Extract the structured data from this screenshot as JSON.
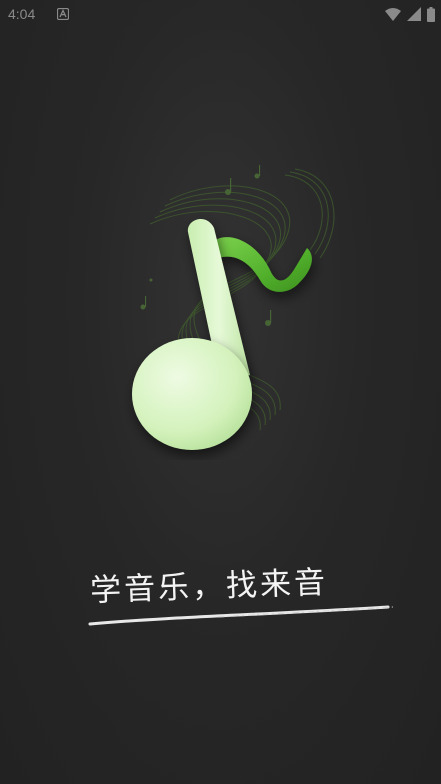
{
  "status_bar": {
    "time": "4:04",
    "icons": [
      "app-notification-icon",
      "wifi-icon",
      "signal-icon",
      "battery-icon"
    ]
  },
  "splash": {
    "logo_icon": "music-note-icon",
    "slogan": "学音乐，找来音",
    "colors": {
      "background": "#262626",
      "note_light": "#d8f5c0",
      "note_dark": "#4caf29",
      "staff_line": "#3f5a2e"
    }
  }
}
